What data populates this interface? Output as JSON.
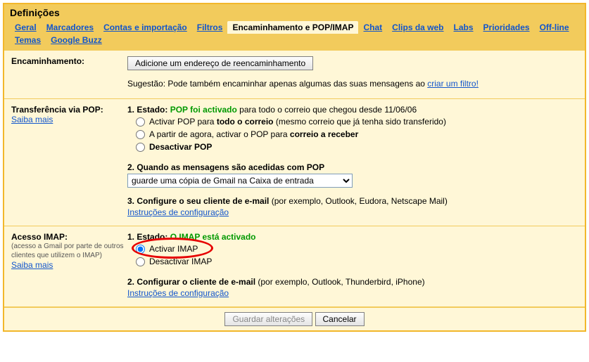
{
  "title": "Definições",
  "tabs": [
    "Geral",
    "Marcadores",
    "Contas e importação",
    "Filtros",
    "Encaminhamento e POP/IMAP",
    "Chat",
    "Clips da web",
    "Labs",
    "Prioridades",
    "Off-line",
    "Temas",
    "Google Buzz"
  ],
  "active_tab": "Encaminhamento e POP/IMAP",
  "forwarding": {
    "label": "Encaminhamento:",
    "add_button": "Adicione um endereço de reencaminhamento",
    "suggestion_prefix": "Sugestão: Pode também encaminhar apenas algumas das suas mensagens ao ",
    "suggestion_link": "criar um filtro!"
  },
  "pop": {
    "label": "Transferência via POP:",
    "learn_more": "Saiba mais",
    "status_label": "1. Estado: ",
    "status_green": "POP foi activado",
    "status_suffix": " para todo o correio que chegou desde 11/06/06",
    "opt1_a": "Activar POP para ",
    "opt1_b": "todo o correio",
    "opt1_c": " (mesmo correio que já tenha sido transferido)",
    "opt2_a": "A partir de agora, activar o POP para ",
    "opt2_b": "correio a receber",
    "opt3": "Desactivar POP",
    "heading2": "2. Quando as mensagens são acedidas com POP",
    "select_value": "guarde uma cópia de Gmail na Caixa de entrada",
    "heading3_a": "3. Configure o seu cliente de e-mail ",
    "heading3_b": "(por exemplo, Outlook, Eudora, Netscape Mail)",
    "config_link": "Instruções de configuração"
  },
  "imap": {
    "label": "Acesso IMAP:",
    "sub": "(acesso a Gmail por parte de outros clientes que utilizem o IMAP)",
    "learn_more": "Saiba mais",
    "status_label": "1. Estado: ",
    "status_green": "O IMAP está activado",
    "opt1": "Activar IMAP",
    "opt2": "Desactivar IMAP",
    "heading2_a": "2. Configurar o cliente de e-mail ",
    "heading2_b": "(por exemplo, Outlook, Thunderbird, iPhone)",
    "config_link": "Instruções de configuração"
  },
  "footer": {
    "save": "Guardar alterações",
    "cancel": "Cancelar"
  }
}
